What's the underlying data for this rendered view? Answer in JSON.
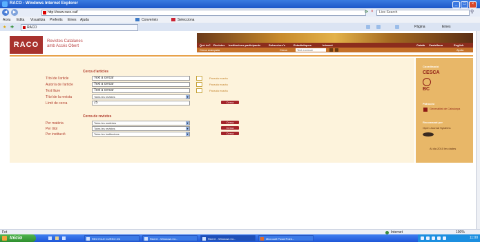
{
  "window": {
    "title": "RACO - Windows Internet Explorer"
  },
  "address": {
    "url": "http://www.raco.cat/",
    "search_placeholder": "Live Search"
  },
  "menu": [
    "Arxiu",
    "Edita",
    "Visualitza",
    "Preferits",
    "Eines",
    "Ajuda"
  ],
  "toolbar": {
    "convert": "Converteix",
    "select": "Selecciona"
  },
  "tab": {
    "label": "RACO"
  },
  "tab_tools": {
    "page": "Pàgina",
    "tools": "Eines"
  },
  "site": {
    "logo": "RACO",
    "name_line1": "Revistes Catalanes",
    "name_line2": "amb Accés Obert",
    "nav": [
      "Què és?",
      "Revistes",
      "Institucions participants",
      "Subscriure's",
      "Estadístiques",
      "Intranet"
    ],
    "nav_right": [
      "Català",
      "Castellano",
      "English"
    ],
    "sub": [
      "Cerca avançada",
      "Cerca"
    ],
    "sub_box": "Text a cercar",
    "sub_right": "Ajuda"
  },
  "article_search": {
    "title": "Cerca d'articles",
    "fields": [
      {
        "label": "Títol de l'article",
        "value": "Text a cercar",
        "check_label": "Paraula exacta"
      },
      {
        "label": "Autor/a de l'article",
        "value": "Text a cercar",
        "check_label": "Paraula exacta"
      },
      {
        "label": "Text lliure",
        "value": "Text a cercar",
        "check_label": "Paraula exacta"
      }
    ],
    "journal_label": "Títol de la revista",
    "journal_value": "Totes les revistes",
    "limit_label": "Límit de cerca",
    "limit_value": "25",
    "button": "Cerca"
  },
  "journal_search": {
    "title": "Cerca de revistes",
    "rows": [
      {
        "label": "Per matèria",
        "value": "Totes les matèries",
        "button": "Cerca"
      },
      {
        "label": "Per títol",
        "value": "Totes les revistes",
        "button": "Cerca"
      },
      {
        "label": "Per institució",
        "value": "Totes les institucions",
        "button": "Cerca"
      }
    ]
  },
  "sidebar": {
    "heading1": "Coordinació",
    "logo1": "CESCA",
    "logo2": "BC",
    "heading2": "Patrocini",
    "logo3": "Generalitat de Catalunya",
    "heading3": "Recomanat per",
    "rec_text": "Open Journal Systems",
    "updated": "Al dia 2010 les dades"
  },
  "status": {
    "left": "Fet",
    "zone": "Internet",
    "zoom": "100%"
  },
  "taskbar": {
    "start": "Inicio",
    "buttons": [
      "RECYCLE CURSO 2/4",
      "RACO - Windows Int...",
      "RACO - Windows Int...",
      "Microsoft PowerPoint..."
    ],
    "clock": "11:00"
  }
}
